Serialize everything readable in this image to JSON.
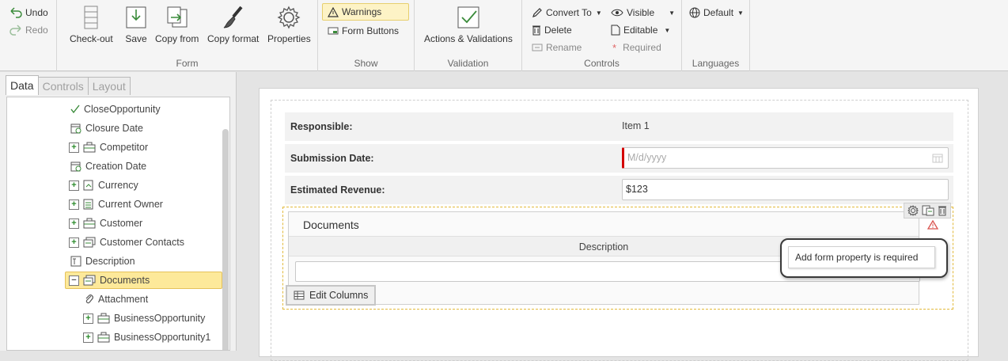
{
  "ribbon": {
    "undo": "Undo",
    "redo": "Redo",
    "form_group": {
      "label": "Form",
      "checkout": "Check-out",
      "save": "Save",
      "copy_from": "Copy from",
      "copy_format": "Copy format",
      "properties": "Properties"
    },
    "show_group": {
      "label": "Show",
      "warnings": "Warnings",
      "form_buttons": "Form Buttons"
    },
    "validation_group": {
      "label": "Validation",
      "actions_validations": "Actions & Validations"
    },
    "controls_group": {
      "label": "Controls",
      "convert_to": "Convert To",
      "delete": "Delete",
      "rename": "Rename",
      "visible": "Visible",
      "editable": "Editable",
      "required": "Required"
    },
    "languages_group": {
      "label": "Languages",
      "default": "Default"
    }
  },
  "left_panel": {
    "tabs": [
      "Data",
      "Controls",
      "Layout"
    ],
    "active_tab": "Data",
    "tree": [
      {
        "label": "CloseOpportunity",
        "icon": "check-icon"
      },
      {
        "label": "Closure Date",
        "icon": "calendar-icon"
      },
      {
        "label": "Competitor",
        "icon": "entity-icon"
      },
      {
        "label": "Creation Date",
        "icon": "calendar-icon"
      },
      {
        "label": "Currency",
        "icon": "currency-icon"
      },
      {
        "label": "Current Owner",
        "icon": "user-icon"
      },
      {
        "label": "Customer",
        "icon": "entity-icon"
      },
      {
        "label": "Customer Contacts",
        "icon": "list-icon"
      },
      {
        "label": "Description",
        "icon": "text-icon"
      },
      {
        "label": "Documents",
        "icon": "list-icon"
      },
      {
        "label": "Attachment",
        "icon": "paperclip-icon"
      },
      {
        "label": "BusinessOpportunity",
        "icon": "entity-icon"
      },
      {
        "label": "BusinessOpportunity1",
        "icon": "entity-icon"
      }
    ]
  },
  "form": {
    "responsible": {
      "label": "Responsible:",
      "value": "Item 1"
    },
    "submission_date": {
      "label": "Submission Date:",
      "placeholder": "M/d/yyyy"
    },
    "estimated_revenue": {
      "label": "Estimated Revenue:",
      "value": "$123"
    },
    "documents": {
      "title": "Documents",
      "column_header": "Description",
      "edit_columns": "Edit Columns",
      "tooltip": "Add form property is required"
    }
  },
  "colors": {
    "selected_bg": "#fde99a",
    "required_marker": "#d40000",
    "warning": "#d9534f"
  }
}
